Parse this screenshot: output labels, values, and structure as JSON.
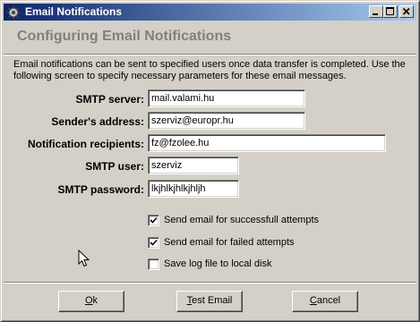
{
  "window": {
    "title": "Email Notifications",
    "controls": {
      "minimize": "minimize-icon",
      "maximize": "maximize-icon",
      "close": "close-icon"
    }
  },
  "header": {
    "title": "Configuring Email Notifications"
  },
  "description": "Email notifications can be sent to specified users once data transfer is completed. Use the following screen to specify necessary parameters for these email messages.",
  "form": {
    "smtp_server": {
      "label": "SMTP server:",
      "value": "mail.valami.hu"
    },
    "sender_address": {
      "label": "Sender's address:",
      "value": "szerviz@europr.hu"
    },
    "notification_recipients": {
      "label": "Notification recipients:",
      "value": "fz@fzolee.hu"
    },
    "smtp_user": {
      "label": "SMTP user:",
      "value": "szerviz"
    },
    "smtp_password": {
      "label": "SMTP password:",
      "value": "lkjhlkjhlkjhljh"
    }
  },
  "options": [
    {
      "label": "Send email for successfull attempts",
      "checked": true
    },
    {
      "label": "Send email for failed attempts",
      "checked": true
    },
    {
      "label": "Save log file to local disk",
      "checked": false
    }
  ],
  "buttons": {
    "ok": {
      "label": "Ok",
      "mnemonic": "O"
    },
    "test_email": {
      "label": "Test Email",
      "mnemonic": "T"
    },
    "cancel": {
      "label": "Cancel",
      "mnemonic": "C"
    }
  },
  "colors": {
    "titlebar_start": "#0a246a",
    "titlebar_end": "#a6caf0",
    "face": "#d4d0c8",
    "header_title": "#808080"
  }
}
